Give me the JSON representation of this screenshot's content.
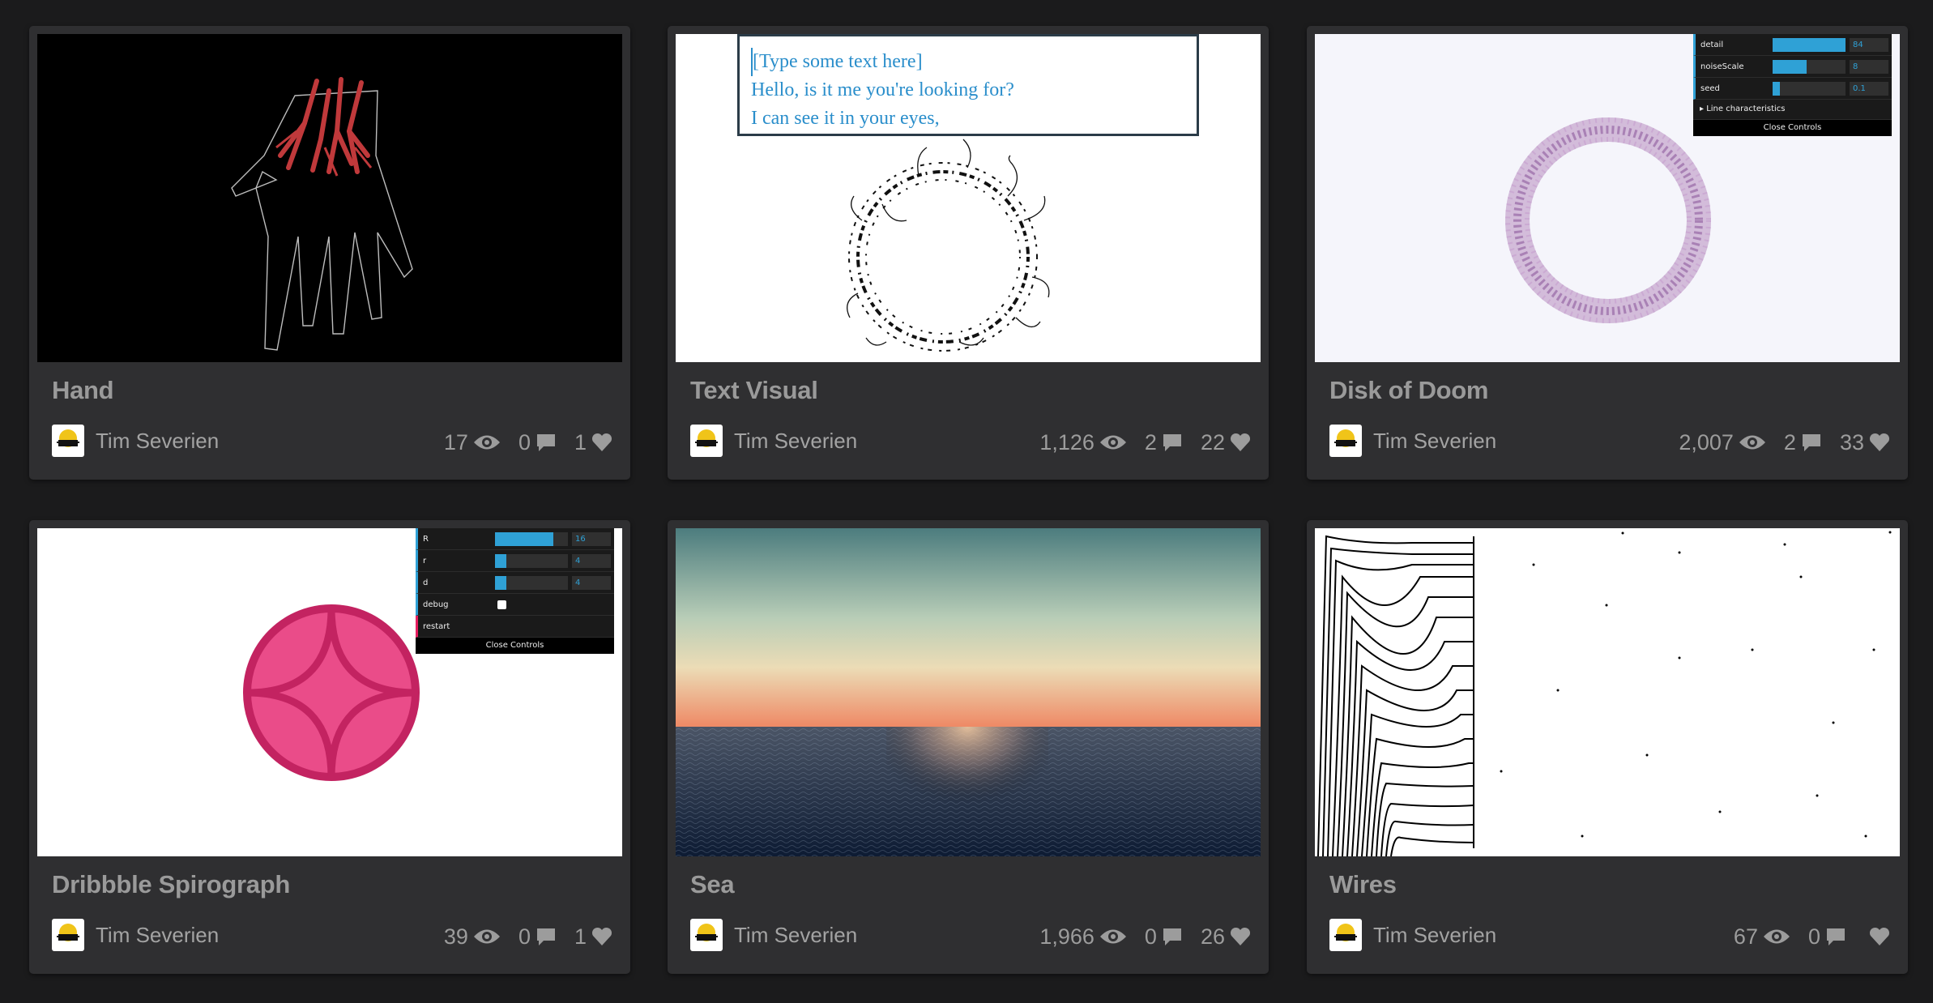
{
  "cards": [
    {
      "title": "Hand",
      "author": "Tim Severien",
      "views": "17",
      "comments": "0",
      "likes": "1"
    },
    {
      "title": "Text Visual",
      "author": "Tim Severien",
      "views": "1,126",
      "comments": "2",
      "likes": "22",
      "preview_text": [
        "[Type some text here]",
        "Hello, is it me you're looking for?",
        "I can see it in your eyes,"
      ]
    },
    {
      "title": "Disk of Doom",
      "author": "Tim Severien",
      "views": "2,007",
      "comments": "2",
      "likes": "33",
      "controls": {
        "rows": [
          {
            "label": "detail",
            "value": "84",
            "fill": 0.84
          },
          {
            "label": "noiseScale",
            "value": "8",
            "fill": 0.47
          },
          {
            "label": "seed",
            "value": "0.1",
            "fill": 0.1
          }
        ],
        "folder": "Line characteristics",
        "close": "Close Controls"
      }
    },
    {
      "title": "Dribbble Spirograph",
      "author": "Tim Severien",
      "views": "39",
      "comments": "0",
      "likes": "1",
      "controls": {
        "rows": [
          {
            "label": "R",
            "value": "16",
            "fill": 0.8
          },
          {
            "label": "r",
            "value": "4",
            "fill": 0.16
          },
          {
            "label": "d",
            "value": "4",
            "fill": 0.16
          }
        ],
        "debug_label": "debug",
        "restart_label": "restart",
        "close": "Close Controls"
      }
    },
    {
      "title": "Sea",
      "author": "Tim Severien",
      "views": "1,966",
      "comments": "0",
      "likes": "26"
    },
    {
      "title": "Wires",
      "author": "Tim Severien",
      "views": "67",
      "comments": "0",
      "likes": ""
    }
  ],
  "colors": {
    "background": "#1b1b1c",
    "card": "#2f2f31",
    "text": "#9a9a9a",
    "dat_accent": "#2fa1d6"
  }
}
